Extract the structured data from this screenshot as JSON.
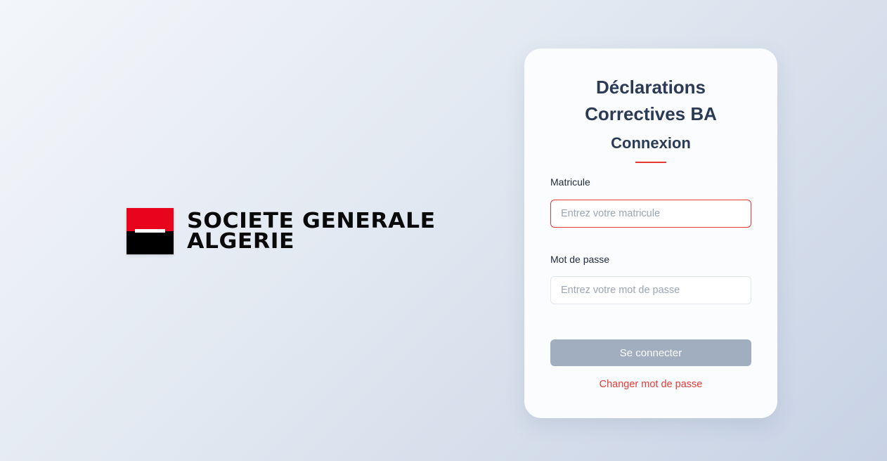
{
  "brand": {
    "logo_line1": "SOCIETE GENERALE",
    "logo_line2": "ALGERIE",
    "colors": {
      "red": "#e9041e",
      "black": "#000000"
    }
  },
  "login": {
    "title_line1": "Déclarations",
    "title_line2": "Correctives BA",
    "subtitle": "Connexion",
    "matricule": {
      "label": "Matricule",
      "placeholder": "Entrez votre matricule",
      "value": ""
    },
    "password": {
      "label": "Mot de passe",
      "placeholder": "Entrez votre mot de passe",
      "value": ""
    },
    "submit_label": "Se connecter",
    "change_password_label": "Changer mot de passe"
  },
  "colors": {
    "accent": "#e53935",
    "heading": "#2b3b55",
    "button_disabled": "#a0aec0"
  }
}
